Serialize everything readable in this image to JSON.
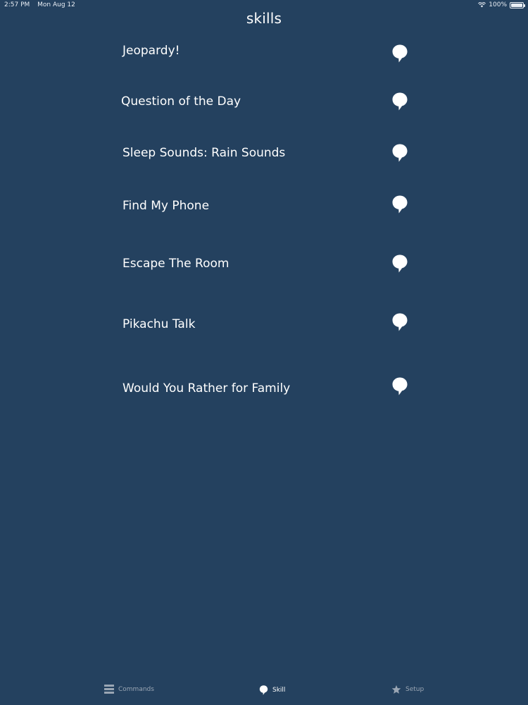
{
  "status_bar": {
    "time": "2:57 PM",
    "date": "Mon Aug 12",
    "battery": "100%",
    "battery_level": 1.0,
    "wifi_icon": "wifi-icon",
    "battery_icon": "battery-icon"
  },
  "header": {
    "title": "skills"
  },
  "skills": {
    "items": [
      {
        "label": "Jeopardy!",
        "icon": "speech-bubble-icon"
      },
      {
        "label": "Question of the Day",
        "icon": "speech-bubble-icon"
      },
      {
        "label": "Sleep Sounds: Rain Sounds",
        "icon": "speech-bubble-icon"
      },
      {
        "label": "Find My Phone",
        "icon": "speech-bubble-icon"
      },
      {
        "label": "Escape The Room",
        "icon": "speech-bubble-icon"
      },
      {
        "label": "Pikachu Talk",
        "icon": "speech-bubble-icon"
      },
      {
        "label": "Would You Rather for Family",
        "icon": "speech-bubble-icon"
      }
    ]
  },
  "tab_bar": {
    "tabs": [
      {
        "label": "Commands",
        "icon": "list-icon",
        "active": false
      },
      {
        "label": "Skill",
        "icon": "speech-bubble-icon",
        "active": true
      },
      {
        "label": "Setup",
        "icon": "star-icon",
        "active": false
      }
    ]
  },
  "colors": {
    "background": "#24415f",
    "text": "#ffffff",
    "inactive_tab": "#9aa6b4"
  }
}
